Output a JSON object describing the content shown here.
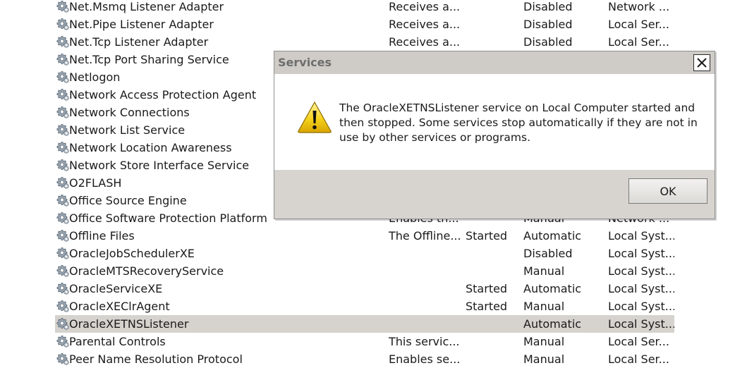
{
  "services": [
    {
      "name": "Net.Msmq Listener Adapter",
      "description": "Receives a...",
      "status": "",
      "startup": "Disabled",
      "logon": "Network ..."
    },
    {
      "name": "Net.Pipe Listener Adapter",
      "description": "Receives a...",
      "status": "",
      "startup": "Disabled",
      "logon": "Local Ser..."
    },
    {
      "name": "Net.Tcp Listener Adapter",
      "description": "Receives a...",
      "status": "",
      "startup": "Disabled",
      "logon": "Local Ser..."
    },
    {
      "name": "Net.Tcp Port Sharing Service",
      "description": "",
      "status": "",
      "startup": "",
      "logon": ""
    },
    {
      "name": "Netlogon",
      "description": "",
      "status": "",
      "startup": "",
      "logon": ""
    },
    {
      "name": "Network Access Protection Agent",
      "description": "",
      "status": "",
      "startup": "",
      "logon": ""
    },
    {
      "name": "Network Connections",
      "description": "",
      "status": "",
      "startup": "",
      "logon": ""
    },
    {
      "name": "Network List Service",
      "description": "",
      "status": "",
      "startup": "",
      "logon": ""
    },
    {
      "name": "Network Location Awareness",
      "description": "",
      "status": "",
      "startup": "",
      "logon": ""
    },
    {
      "name": "Network Store Interface Service",
      "description": "",
      "status": "",
      "startup": "",
      "logon": ""
    },
    {
      "name": "O2FLASH",
      "description": "",
      "status": "",
      "startup": "",
      "logon": ""
    },
    {
      "name": "Office  Source Engine",
      "description": "",
      "status": "",
      "startup": "",
      "logon": ""
    },
    {
      "name": "Office Software Protection Platform",
      "description": "Enables th...",
      "status": "",
      "startup": "Manual",
      "logon": "Network ..."
    },
    {
      "name": "Offline Files",
      "description": "The Offline...",
      "status": "Started",
      "startup": "Automatic",
      "logon": "Local Syst..."
    },
    {
      "name": "OracleJobSchedulerXE",
      "description": "",
      "status": "",
      "startup": "Disabled",
      "logon": "Local Syst..."
    },
    {
      "name": "OracleMTSRecoveryService",
      "description": "",
      "status": "",
      "startup": "Manual",
      "logon": "Local Syst..."
    },
    {
      "name": "OracleServiceXE",
      "description": "",
      "status": "Started",
      "startup": "Automatic",
      "logon": "Local Syst..."
    },
    {
      "name": "OracleXEClrAgent",
      "description": "",
      "status": "Started",
      "startup": "Manual",
      "logon": "Local Syst..."
    },
    {
      "name": "OracleXETNSListener",
      "description": "",
      "status": "",
      "startup": "Automatic",
      "logon": "Local Syst...",
      "selected": true
    },
    {
      "name": "Parental Controls",
      "description": "This servic...",
      "status": "",
      "startup": "Manual",
      "logon": "Local Ser..."
    },
    {
      "name": "Peer Name Resolution Protocol",
      "description": "Enables se...",
      "status": "",
      "startup": "Manual",
      "logon": "Local Ser..."
    }
  ],
  "row_icon": "gear-icon",
  "colors": {
    "selected_row": "#d6d3ce",
    "dialog_face": "#d7d4cf",
    "dialog_title_text": "#6e6e6e",
    "warning_yellow": "#f5d21c"
  },
  "dialog": {
    "title": "Services",
    "message": "The OracleXETNSListener service on Local Computer started and then stopped. Some services stop automatically if they are not in use by other services or programs.",
    "ok_label": "OK",
    "close_icon": "close-icon",
    "message_icon": "warning-icon"
  }
}
